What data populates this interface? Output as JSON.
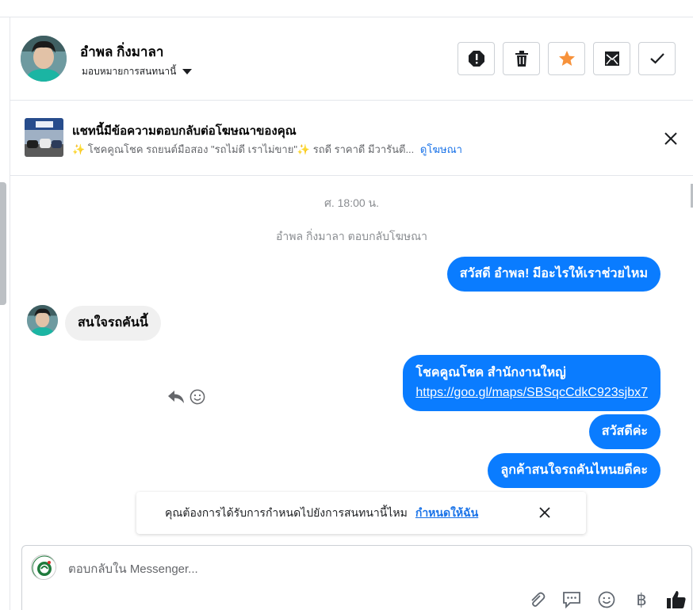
{
  "header": {
    "contact_name": "อำพล กิ่งมาลา",
    "assign_label": "มอบหมายการสนทนานี้",
    "actions": [
      "spam-icon",
      "trash-icon",
      "star-icon",
      "mark-unread-icon",
      "check-icon"
    ],
    "star_color": "#f7923b"
  },
  "ad_banner": {
    "title": "แชทนี้มีข้อความตอบกลับต่อโฆษณาของคุณ",
    "subtitle": "✨ โชคคูณโชค รถยนต์มือสอง \"รถไม่ดี เราไม่ขาย\"✨ รถดี ราคาดี มีวารันตี...",
    "link_label": "ดูโฆษณา"
  },
  "thread": {
    "timestamp": "ศ. 18:00 น.",
    "system_note": "อำพล กิ่งมาลา ตอบกลับโฆษณา",
    "messages": [
      {
        "from": "page",
        "text": "สวัสดี อำพล! มีอะไรให้เราช่วยไหม"
      },
      {
        "from": "user",
        "text": "สนใจรถคันนี้"
      },
      {
        "from": "page",
        "text": "โชคคูณโชค สำนักงานใหญ่",
        "link": "https://goo.gl/maps/SBSqcCdkC923sjbx7"
      },
      {
        "from": "page",
        "text": "สวัสดีค่ะ"
      },
      {
        "from": "page",
        "text": "ลูกค้าสนใจรถคันไหนยดีคะ"
      }
    ],
    "bubble_color": "#0a7cff"
  },
  "toast": {
    "text": "คุณต้องการได้รับการกำหนดไปยังการสนทนานี้ไหม",
    "link_label": "กำหนดให้ฉัน"
  },
  "composer": {
    "placeholder": "ตอบกลับใน Messenger...",
    "value": "",
    "tools": [
      "attach-icon",
      "saved-reply-icon",
      "emoji-icon",
      "payment-icon",
      "like-icon"
    ],
    "payment_symbol": "฿"
  }
}
